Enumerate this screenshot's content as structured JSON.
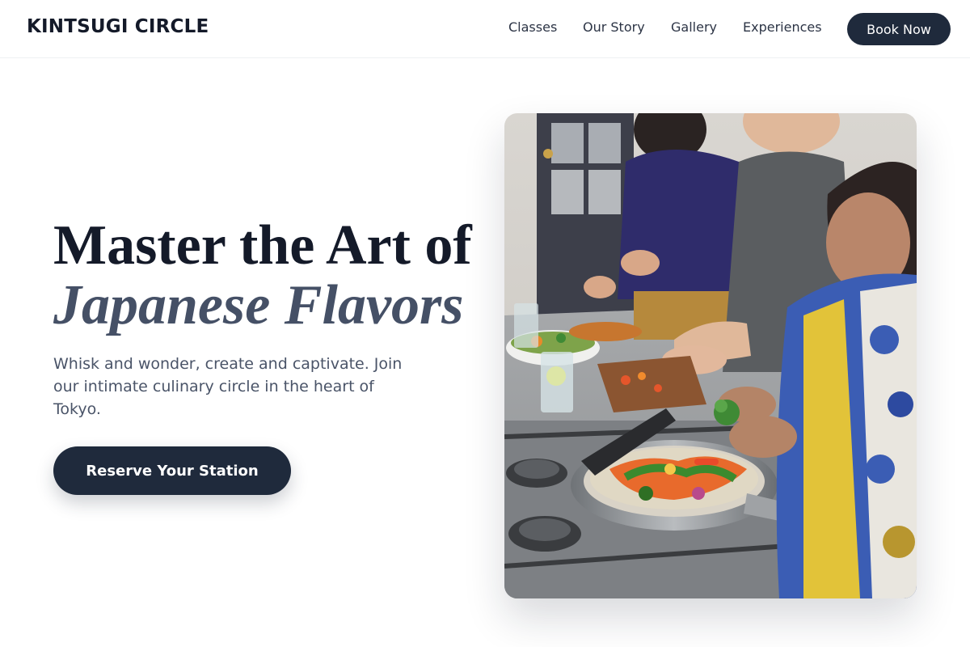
{
  "header": {
    "logo": "KINTSUGI CIRCLE",
    "nav": [
      "Classes",
      "Our Story",
      "Gallery",
      "Experiences"
    ],
    "book_label": "Book Now"
  },
  "hero": {
    "title_line1": "Master the Art of",
    "title_line2": "Japanese Flavors",
    "subtitle": "Whisk and wonder, create and captivate. Join our intimate culinary circle in the heart of Tokyo.",
    "cta_label": "Reserve Your Station"
  },
  "photo": {
    "subject": "people cooking vegetables in a pan on a stove in a kitchen"
  },
  "colors": {
    "primary": "#1f2a3c",
    "title_dark": "#141a29",
    "title_accent": "#455066",
    "body_text": "#4a5468"
  }
}
